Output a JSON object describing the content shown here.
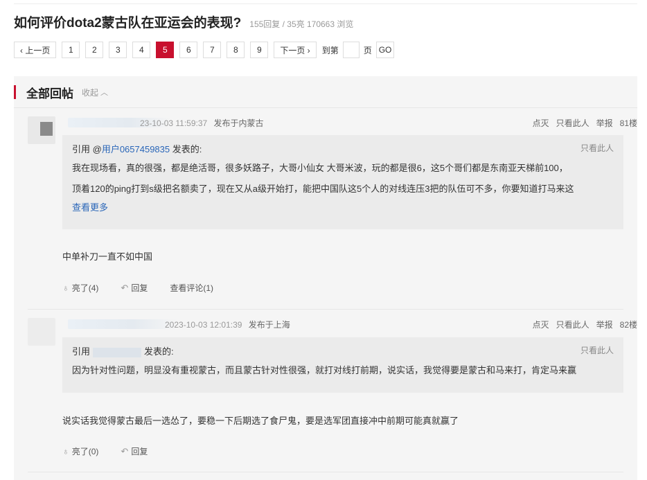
{
  "thread": {
    "title": "如何评价dota2蒙古队在亚运会的表现?",
    "stats": "155回复 / 35亮 170663 浏览"
  },
  "pager": {
    "prev": "‹ 上一页",
    "pages": [
      "1",
      "2",
      "3",
      "4",
      "5",
      "6",
      "7",
      "8",
      "9"
    ],
    "current": "5",
    "next": "下一页 ›",
    "goto_prefix": "到第",
    "goto_suffix": "页",
    "go": "GO"
  },
  "section": {
    "title": "全部回帖",
    "collapse": "收起"
  },
  "posts": [
    {
      "time": "23-10-03 11:59:37",
      "location": "发布于内蒙古",
      "actions": [
        "点灭",
        "只看此人",
        "举报",
        "81楼"
      ],
      "quote": {
        "prefix": "引用 @",
        "user": "用户0657459835",
        "suffix": " 发表的:",
        "only": "只看此人",
        "line1": "我在现场看，真的很强，都是绝活哥，很多妖路子，大哥小仙女 大哥米波，玩的都是很6，这5个哥们都是东南亚天梯前100，",
        "line2": "顶着120的ping打到s级把名额卖了，现在又从a级开始打，能把中国队这5个人的对线连压3把的队伍可不多，你要知道打马来这",
        "more": "查看更多"
      },
      "content": "中单补刀一直不如中国",
      "light": "亮了(4)",
      "reply": "回复",
      "comments": "查看评论(1)"
    },
    {
      "time": "2023-10-03 12:01:39",
      "location": "发布于上海",
      "actions": [
        "点灭",
        "只看此人",
        "举报",
        "82楼"
      ],
      "quote": {
        "prefix": "引用",
        "suffix": "发表的:",
        "only": "只看此人",
        "line1": "因为针对性问题，明显没有重视蒙古，而且蒙古针对性很强，就打对线打前期，说实话，我觉得要是蒙古和马来打，肯定马来赢"
      },
      "content": "说实话我觉得蒙古最后一选怂了，要稳一下后期选了食尸鬼，要是选军团直接冲中前期可能真就赢了",
      "light": "亮了(0)",
      "reply": "回复"
    }
  ],
  "icons": {
    "light": "bulb-icon",
    "reply": "reply-icon",
    "collapse": "chevron-up-icon"
  },
  "colors": {
    "accent": "#c8102e",
    "link": "#2a66b8"
  }
}
